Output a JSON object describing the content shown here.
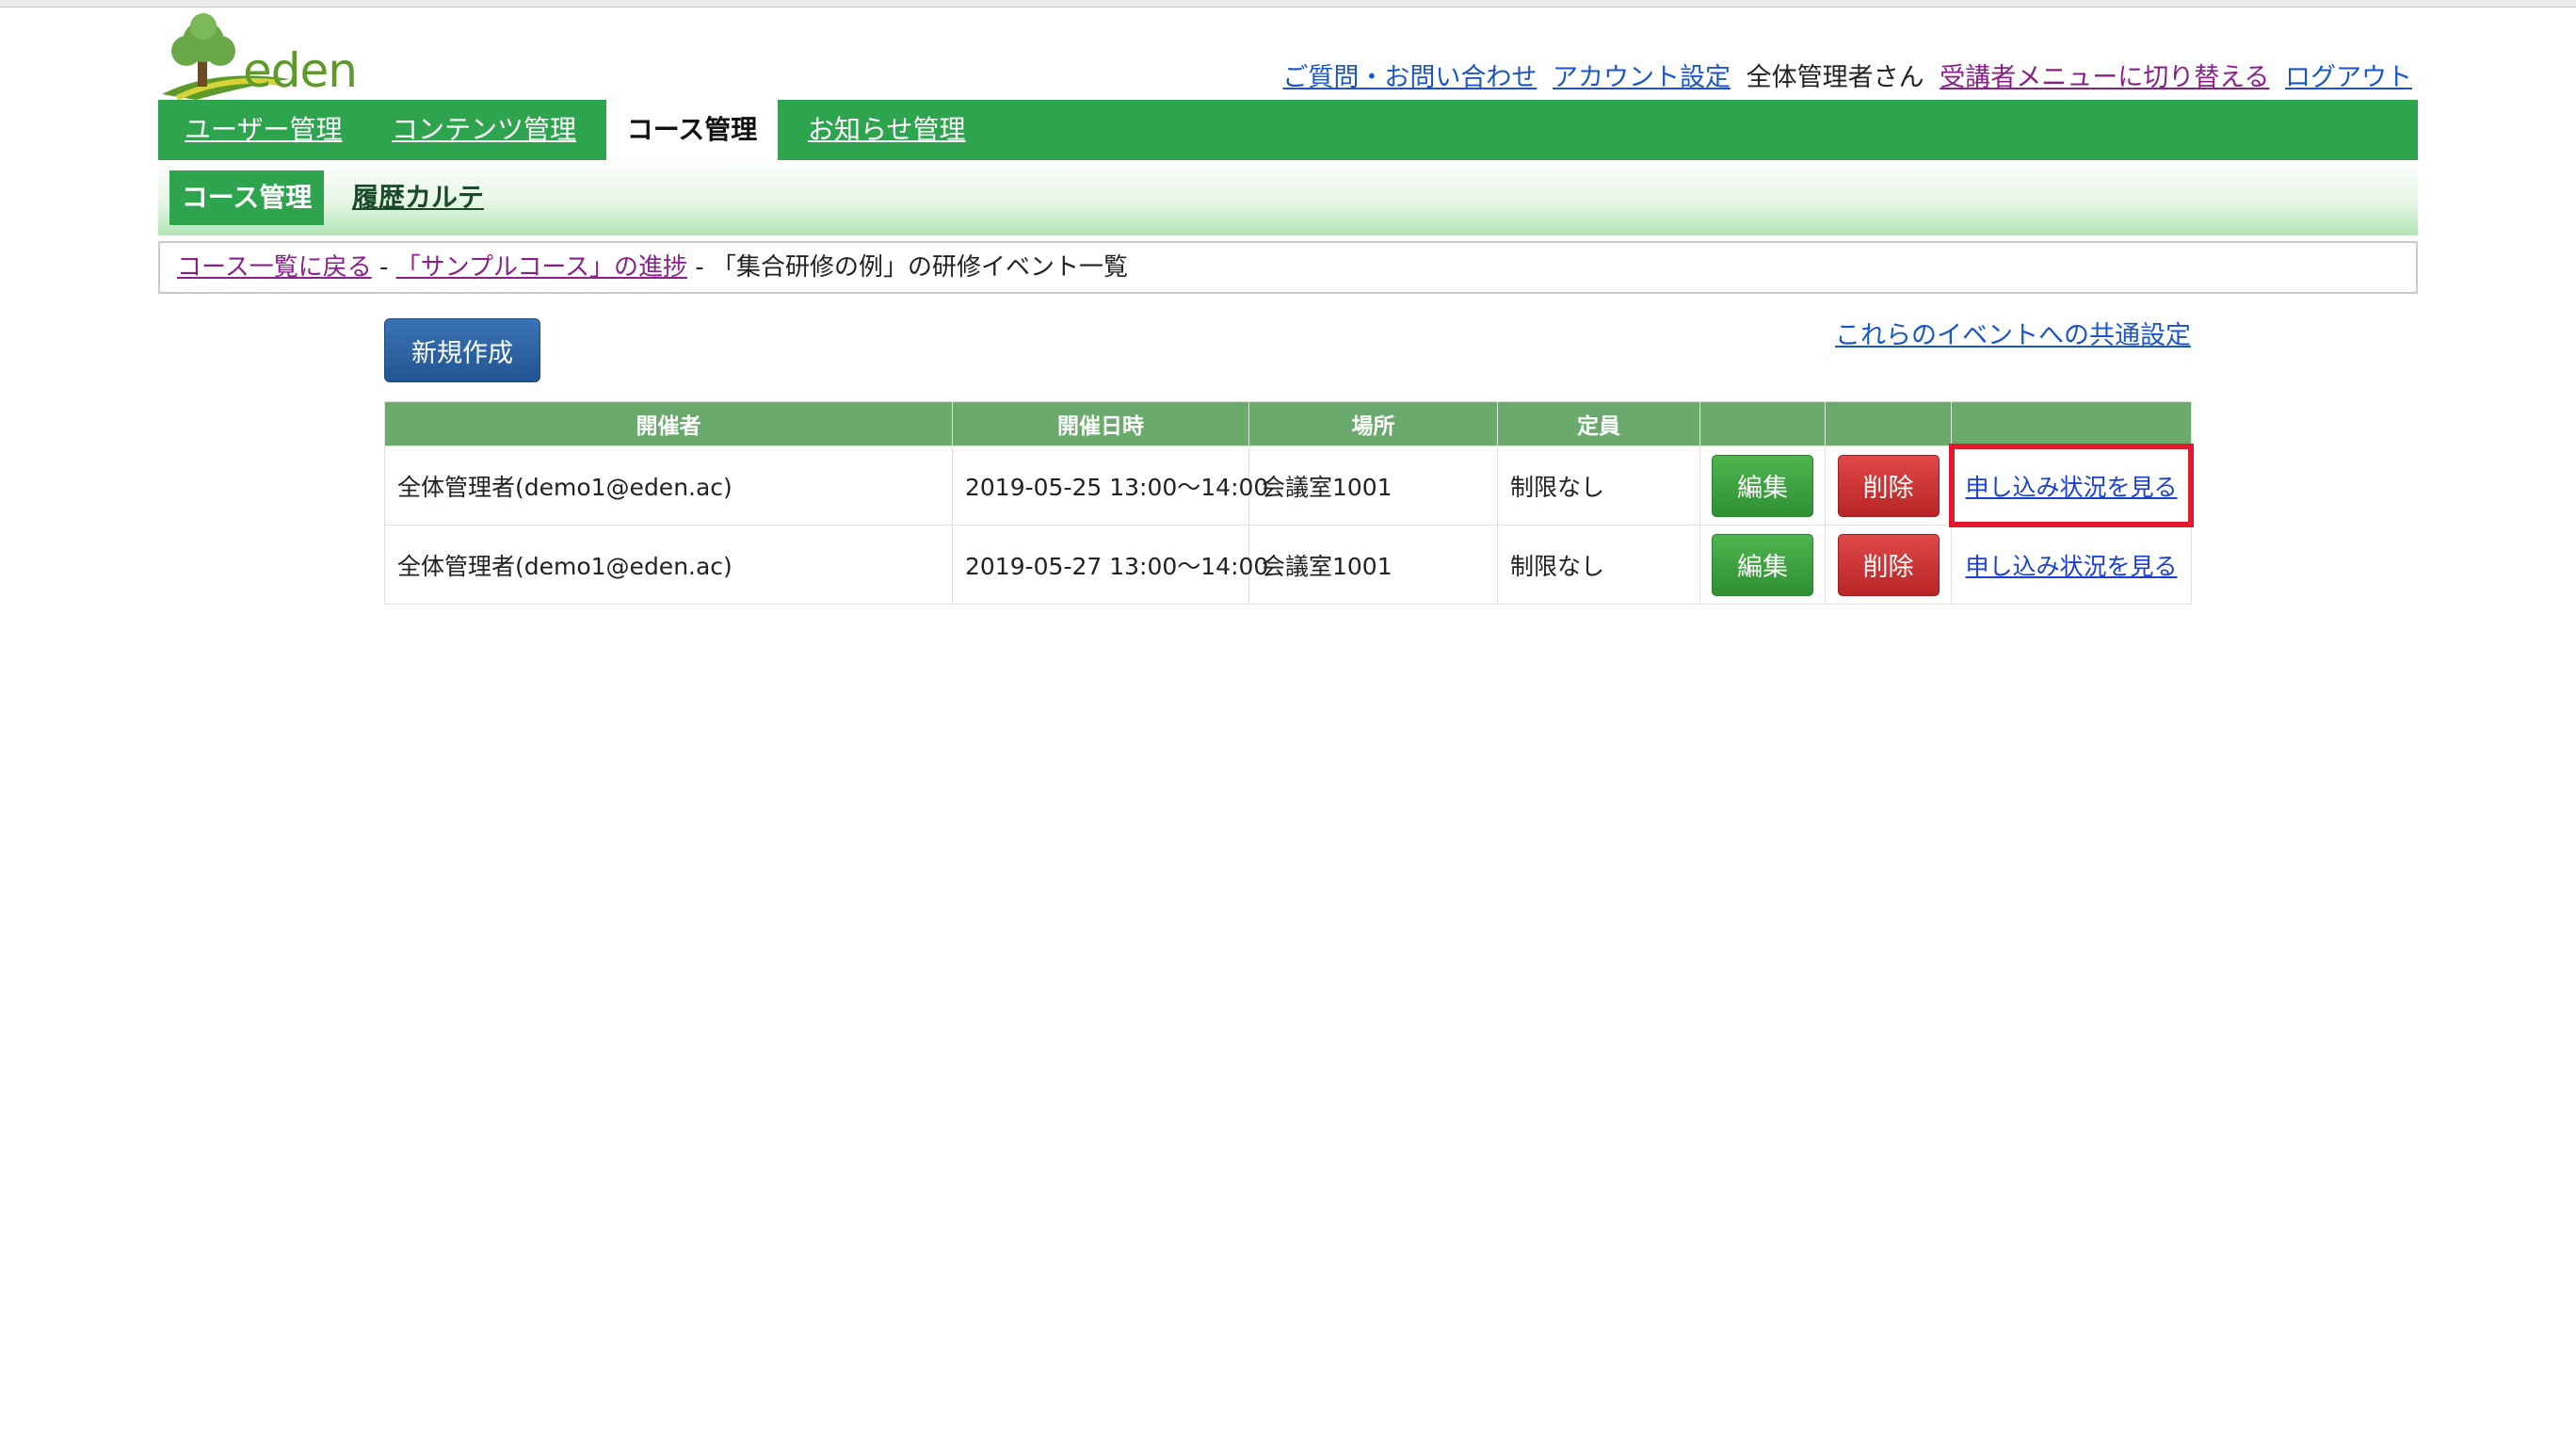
{
  "app": {
    "logo_text": "eden"
  },
  "header": {
    "links": [
      {
        "label": "ご質問・お問い合わせ"
      },
      {
        "label": "アカウント設定"
      }
    ],
    "user_name": "全体管理者さん",
    "switch_menu_label": "受講者メニューに切り替える",
    "logout_label": "ログアウト"
  },
  "main_nav": {
    "tabs": [
      {
        "label": "ユーザー管理",
        "active": false
      },
      {
        "label": "コンテンツ管理",
        "active": false
      },
      {
        "label": "コース管理",
        "active": true
      },
      {
        "label": "お知らせ管理",
        "active": false
      }
    ]
  },
  "sub_nav": {
    "active_label": "コース管理",
    "link_label": "履歴カルテ"
  },
  "breadcrumb": {
    "back_label": "コース一覧に戻る",
    "sep": "-",
    "course_label": "「サンプルコース」の進捗",
    "current": "「集合研修の例」の研修イベント一覧"
  },
  "actions": {
    "new_label": "新規作成",
    "common_settings_label": "これらのイベントへの共通設定"
  },
  "table": {
    "headers": [
      "開催者",
      "開催日時",
      "場所",
      "定員",
      "",
      "",
      ""
    ],
    "rows": [
      {
        "organizer": "全体管理者(demo1@eden.ac)",
        "datetime": "2019-05-25 13:00～14:00",
        "place": "会議室1001",
        "capacity": "制限なし",
        "edit": "編集",
        "delete": "削除",
        "status": "申し込み状況を見る",
        "highlighted": true
      },
      {
        "organizer": "全体管理者(demo1@eden.ac)",
        "datetime": "2019-05-27 13:00～14:00",
        "place": "会議室1001",
        "capacity": "制限なし",
        "edit": "編集",
        "delete": "削除",
        "status": "申し込み状況を見る",
        "highlighted": false
      }
    ]
  },
  "colors": {
    "nav_green": "#2fa44f",
    "header_green": "#6aaa6c",
    "primary_blue": "#225591",
    "edit_green": "#3aa23c",
    "delete_red": "#c92e2e",
    "highlight_red": "#e0192c",
    "link_blue": "#1a56c9",
    "visited_purple": "#8a1f8a"
  }
}
